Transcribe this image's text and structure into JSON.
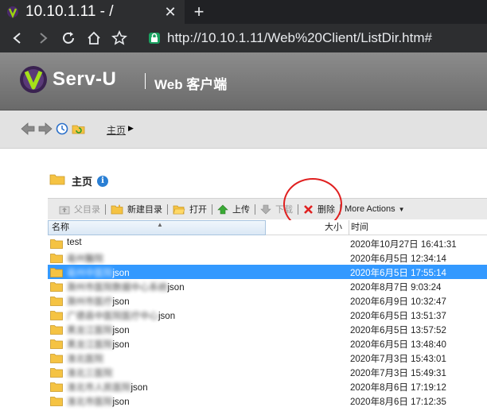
{
  "browser": {
    "tab_title": "10.10.1.11 - /",
    "url": "http://10.10.1.11/Web%20Client/ListDir.htm#"
  },
  "header": {
    "logo_text": "Serv-U",
    "subtitle": "Web 客户端"
  },
  "breadcrumb": {
    "home": "主页"
  },
  "folder": {
    "title": "主页"
  },
  "toolbar": {
    "parent_dir": "父目录",
    "new_dir": "新建目录",
    "open": "打开",
    "upload": "上传",
    "download": "下载",
    "delete": "删除",
    "more": "More Actions"
  },
  "columns": {
    "name": "名称",
    "size": "大小",
    "time": "时间"
  },
  "files": [
    {
      "name": "test",
      "date": "2020年10月27日 16:41:31",
      "selected": false,
      "obscured": false,
      "suffix": ""
    },
    {
      "name": "亳州醫院",
      "date": "2020年6月5日 12:34:14",
      "selected": false,
      "obscured": true,
      "suffix": ""
    },
    {
      "name": "亳州中医院",
      "date": "2020年6月5日 17:55:14",
      "selected": true,
      "obscured": true,
      "suffix": "json"
    },
    {
      "name": "滁州市医院数据中心系统",
      "date": "2020年8月7日 9:03:24",
      "selected": false,
      "obscured": true,
      "suffix": "json"
    },
    {
      "name": "滁州市医疗",
      "date": "2020年6月9日 10:32:47",
      "selected": false,
      "obscured": true,
      "suffix": "json"
    },
    {
      "name": "广德县中医院医疗中心",
      "date": "2020年6月5日 13:51:37",
      "selected": false,
      "obscured": true,
      "suffix": "json"
    },
    {
      "name": "黑龙江医院",
      "date": "2020年6月5日 13:57:52",
      "selected": false,
      "obscured": true,
      "suffix": "json"
    },
    {
      "name": "黑龙江医院",
      "date": "2020年6月5日 13:48:40",
      "selected": false,
      "obscured": true,
      "suffix": "json"
    },
    {
      "name": "淮北医院",
      "date": "2020年7月3日 15:43:01",
      "selected": false,
      "obscured": true,
      "suffix": ""
    },
    {
      "name": "淮北三医院",
      "date": "2020年7月3日 15:49:31",
      "selected": false,
      "obscured": true,
      "suffix": ""
    },
    {
      "name": "淮北市人民医院",
      "date": "2020年8月6日 17:19:12",
      "selected": false,
      "obscured": true,
      "suffix": "json"
    },
    {
      "name": "淮北市医院",
      "date": "2020年8月6日 17:12:35",
      "selected": false,
      "obscured": true,
      "suffix": "json"
    }
  ],
  "colors": {
    "selected_row": "#3399ff",
    "annotation": "#e02020",
    "folder": "#f5c343"
  }
}
